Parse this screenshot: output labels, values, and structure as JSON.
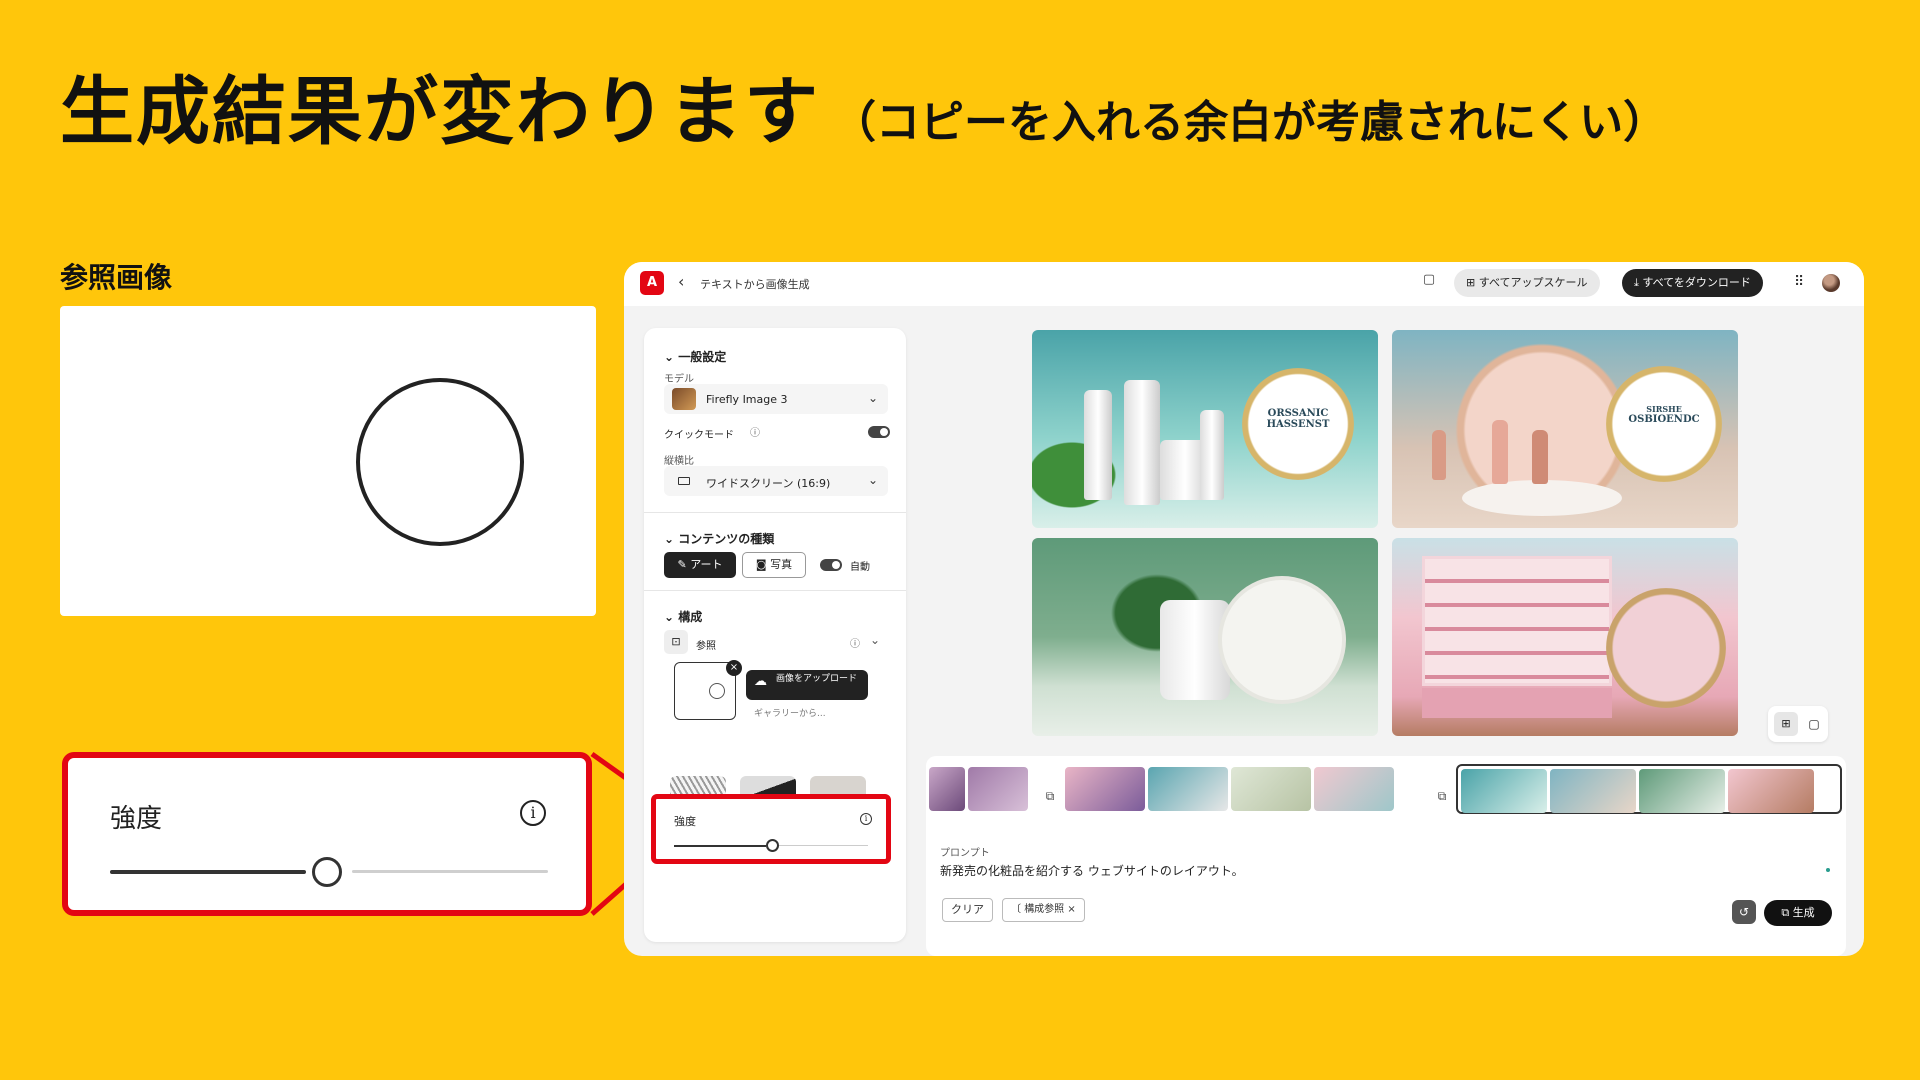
{
  "slide": {
    "title": "生成結果が変わります",
    "subtitle": "（コピーを入れる余白が考慮されにくい）",
    "reference_label": "参照画像",
    "zoom": {
      "label": "強度",
      "info_icon": "i",
      "strength": 0.45
    },
    "colors": {
      "background": "#FFC60B",
      "highlight": "#E30613"
    }
  },
  "app": {
    "logo": "A",
    "breadcrumb": "テキストから画像生成",
    "upscale_all": "すべてアップスケール",
    "download_all": "すべてをダウンロード",
    "panel": {
      "general_settings": "一般設定",
      "model_label": "モデル",
      "model_value": "Firefly Image 3",
      "quick_mode": "クイックモード",
      "quick_mode_on": true,
      "aspect_label": "縦横比",
      "aspect_value": "ワイドスクリーン (16:9)",
      "content_type": "コンテンツの種類",
      "art": "アート",
      "photo": "写真",
      "auto": "自動",
      "composition": "構成",
      "reference": "参照",
      "upload_image": "画像をアップロード",
      "gallery_peek": "ギャラリーから...",
      "strength_label": "強度",
      "strength": 0.45
    },
    "images": [
      {
        "badge_line1": "ORSSANIC",
        "badge_line2": "HASSENST"
      },
      {
        "badge_line1": "SIRSHE",
        "badge_line2": "OSBIOENDC"
      },
      {
        "badge_line1": "",
        "badge_line2": ""
      },
      {
        "badge_line1": "",
        "badge_line2": ""
      }
    ],
    "prompt_label": "プロンプト",
    "prompt_text": "新発売の化粧品を紹介する ウェブサイトのレイアウト。",
    "clear_button": "クリア",
    "composition_chip": "構成参照",
    "chip_close": "×",
    "generate_button": "生成"
  }
}
